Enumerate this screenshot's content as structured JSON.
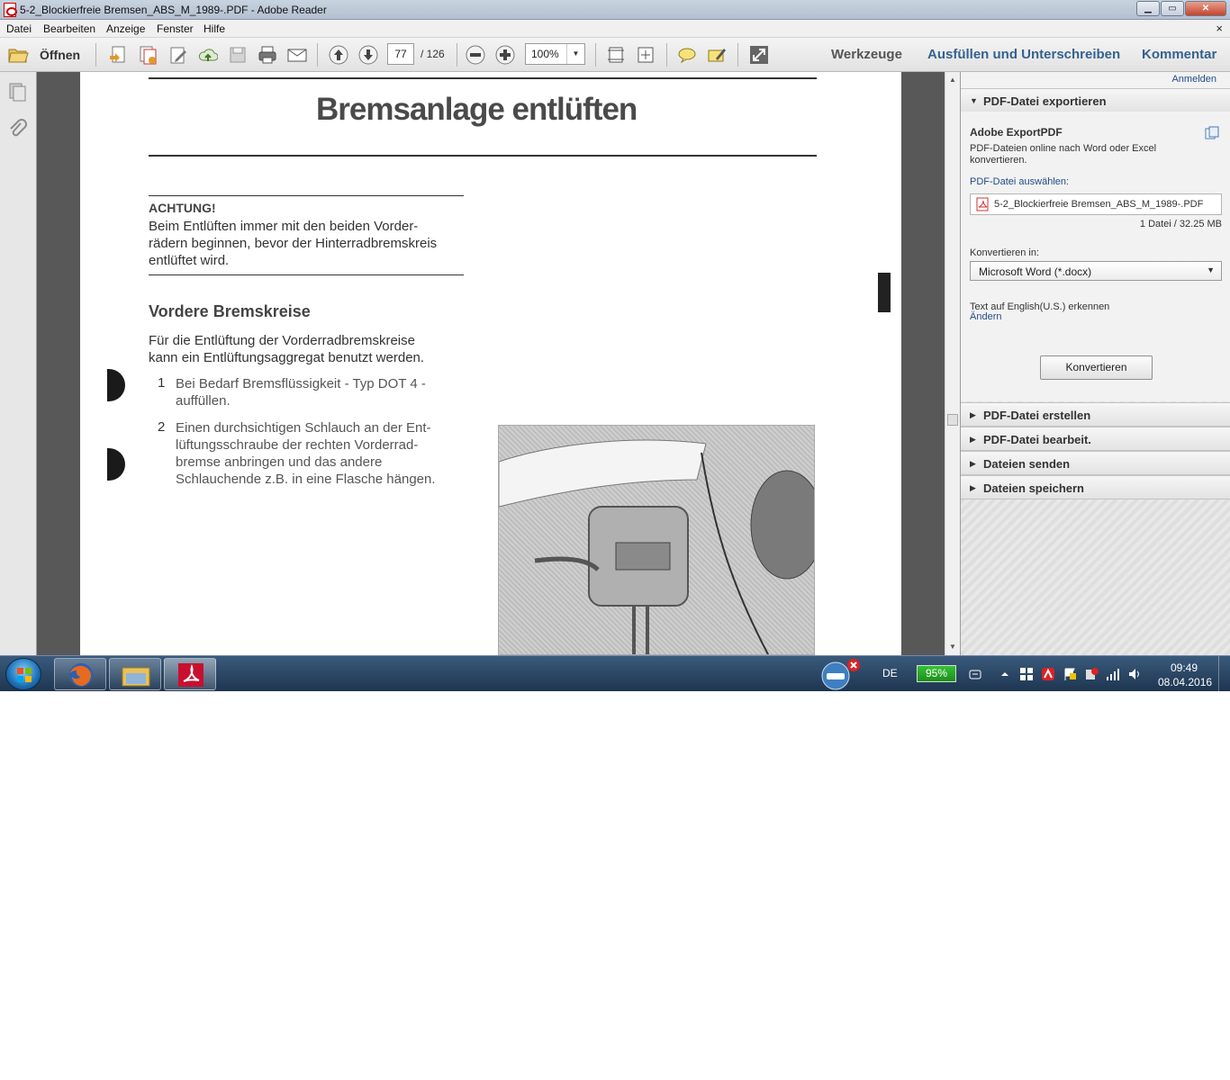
{
  "window": {
    "title": "5-2_Blockierfreie Bremsen_ABS_M_1989-.PDF - Adobe Reader",
    "min": "▁",
    "max": "▭",
    "close": "✕"
  },
  "menu": {
    "items": [
      "Datei",
      "Bearbeiten",
      "Anzeige",
      "Fenster",
      "Hilfe"
    ],
    "close": "×"
  },
  "toolbar": {
    "open_label": "Öffnen",
    "page_current": "77",
    "page_total": "/ 126",
    "zoom": "100%",
    "zoom_arrow": "▼",
    "links": [
      "Werkzeuge",
      "Ausfüllen und Unterschreiben",
      "Kommentar"
    ]
  },
  "document": {
    "title": "Bremsanlage entlüften",
    "warning_heading": "ACHTUNG!",
    "warning_lines": [
      "Beim Entlüften immer mit den beiden Vorder-",
      "rädern beginnen, bevor der Hinterradbremskreis",
      "entlüftet wird."
    ],
    "section_heading": "Vordere Bremskreise",
    "intro_lines": [
      "Für die Entlüftung der Vorderradbremskreise",
      "kann ein Entlüftungsaggregat benutzt werden."
    ],
    "steps": [
      {
        "num": "1",
        "lines": [
          "Bei Bedarf Bremsflüssigkeit - Typ DOT 4 -",
          "auffüllen."
        ]
      },
      {
        "num": "2",
        "lines": [
          "Einen durchsichtigen Schlauch an der Ent-",
          "lüftungsschraube der rechten Vorderrad-",
          "bremse anbringen und das andere",
          "Schlauchende z.B. in eine Flasche hängen."
        ]
      }
    ]
  },
  "right_panel": {
    "sign_in": "Anmelden",
    "export_section": "PDF-Datei exportieren",
    "service_title": "Adobe ExportPDF",
    "service_desc": "PDF-Dateien online nach Word oder Excel konvertieren.",
    "select_label": "PDF-Datei auswählen:",
    "file_name": "5-2_Blockierfreie Bremsen_ABS_M_1989-.PDF",
    "file_info": "1 Datei / 32.25 MB",
    "convert_to_label": "Konvertieren in:",
    "convert_to_value": "Microsoft Word (*.docx)",
    "dropdown_arrow": "▼",
    "ocr_text": "Text auf English(U.S.) erkennen",
    "ocr_change": "Ändern",
    "convert_button": "Konvertieren",
    "expanded_tri": "▼",
    "collapsed_tri": "▶",
    "other_sections": [
      "PDF-Datei erstellen",
      "PDF-Datei bearbeit.",
      "Dateien senden",
      "Dateien speichern"
    ]
  },
  "taskbar": {
    "language": "DE",
    "battery": "95%",
    "time": "09:49",
    "date": "08.04.2016"
  },
  "colors": {
    "link_blue": "#35628f",
    "acrobat_red": "#c8102e",
    "battery_green": "#2aa82a"
  },
  "icons": [
    "open-folder-icon",
    "create-pdf-icon",
    "combine-icon",
    "edit-icon",
    "upload-icon",
    "save-icon",
    "print-icon",
    "email-icon",
    "page-up-icon",
    "page-down-icon",
    "zoom-out-icon",
    "zoom-in-icon",
    "fit-page-icon",
    "fit-width-icon",
    "comment-icon",
    "highlight-icon",
    "fullscreen-icon"
  ]
}
